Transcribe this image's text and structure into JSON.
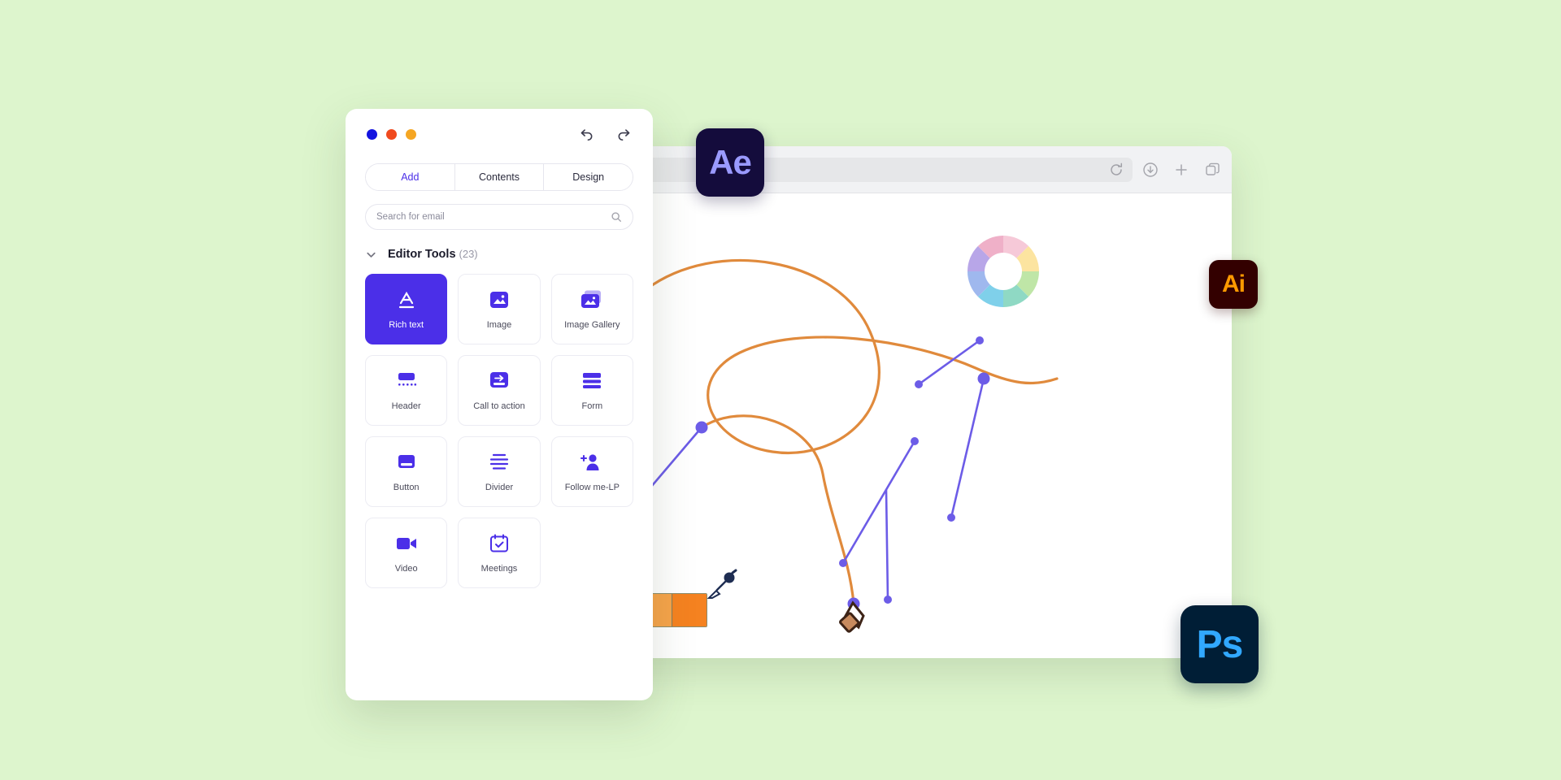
{
  "background_color": "#ddf5cd",
  "editor_panel": {
    "window_dots": [
      {
        "name": "blue-dot",
        "color": "#1414e0"
      },
      {
        "name": "red-dot",
        "color": "#f04a1e"
      },
      {
        "name": "yellow-dot",
        "color": "#f5a623"
      }
    ],
    "undo_label": "undo",
    "redo_label": "redo",
    "tabs": [
      {
        "label": "Add",
        "active": true
      },
      {
        "label": "Contents",
        "active": false
      },
      {
        "label": "Design",
        "active": false
      }
    ],
    "search": {
      "placeholder": "Search for email",
      "value": "",
      "icon": "search-icon"
    },
    "section": {
      "title": "Editor Tools",
      "count": "(23)",
      "expanded": true,
      "chevron_icon": "chevron-down-icon"
    },
    "tools": [
      {
        "label": "Rich text",
        "icon": "rich-text-icon",
        "selected": true
      },
      {
        "label": "Image",
        "icon": "image-icon",
        "selected": false
      },
      {
        "label": "Image Gallery",
        "icon": "gallery-icon",
        "selected": false
      },
      {
        "label": "Header",
        "icon": "header-icon",
        "selected": false
      },
      {
        "label": "Call to action",
        "icon": "cta-icon",
        "selected": false
      },
      {
        "label": "Form",
        "icon": "form-icon",
        "selected": false
      },
      {
        "label": "Button",
        "icon": "button-icon",
        "selected": false
      },
      {
        "label": "Divider",
        "icon": "divider-icon",
        "selected": false
      },
      {
        "label": "Follow me-LP",
        "icon": "follow-icon",
        "selected": false
      },
      {
        "label": "Video",
        "icon": "video-icon",
        "selected": false
      },
      {
        "label": "Meetings",
        "icon": "meetings-icon",
        "selected": false
      }
    ],
    "accent_color": "#4b2fe8"
  },
  "browser": {
    "chrome_icons": [
      "shield-icon",
      "reload-icon",
      "download-icon",
      "new-tab-icon",
      "tabs-icon"
    ],
    "url_value": ""
  },
  "canvas": {
    "tool_palette": {
      "background_color": "#3b2ff0",
      "tools": [
        "cursor-arrow-icon",
        "direct-select-icon",
        "magic-wand-icon",
        "lasso-icon",
        "pen-icon",
        "curve-pen-icon",
        "text-tool-icon",
        "line-tool-icon",
        "ellipse-tool-icon",
        "brush-tool-icon"
      ]
    },
    "color_wheel": {
      "name": "color-wheel",
      "segments": [
        "#f6c9d8",
        "#fce4a0",
        "#bfe6a7",
        "#8fd9c4",
        "#7fd0ea",
        "#9fb8ee",
        "#b8a6e8",
        "#efb0c8"
      ]
    },
    "swatch_strip": {
      "name": "color-swatch-strip",
      "colors": [
        "#fbe28f",
        "#fbc95e",
        "#f7a44a",
        "#f58220"
      ]
    },
    "curve_color": "#e08a3c",
    "path_color": "#6c5ce7",
    "eyedropper_icon": "eyedropper-icon",
    "pen_cursor_icon": "pen-cursor-icon"
  },
  "app_icons": [
    {
      "label": "Ae",
      "name": "after-effects-icon",
      "bg": "#140c3c",
      "fg": "#9a9aff"
    },
    {
      "label": "Ai",
      "name": "illustrator-icon",
      "bg": "#330000",
      "fg": "#ff9a00"
    },
    {
      "label": "Ps",
      "name": "photoshop-icon",
      "bg": "#001e36",
      "fg": "#31a8ff"
    }
  ]
}
